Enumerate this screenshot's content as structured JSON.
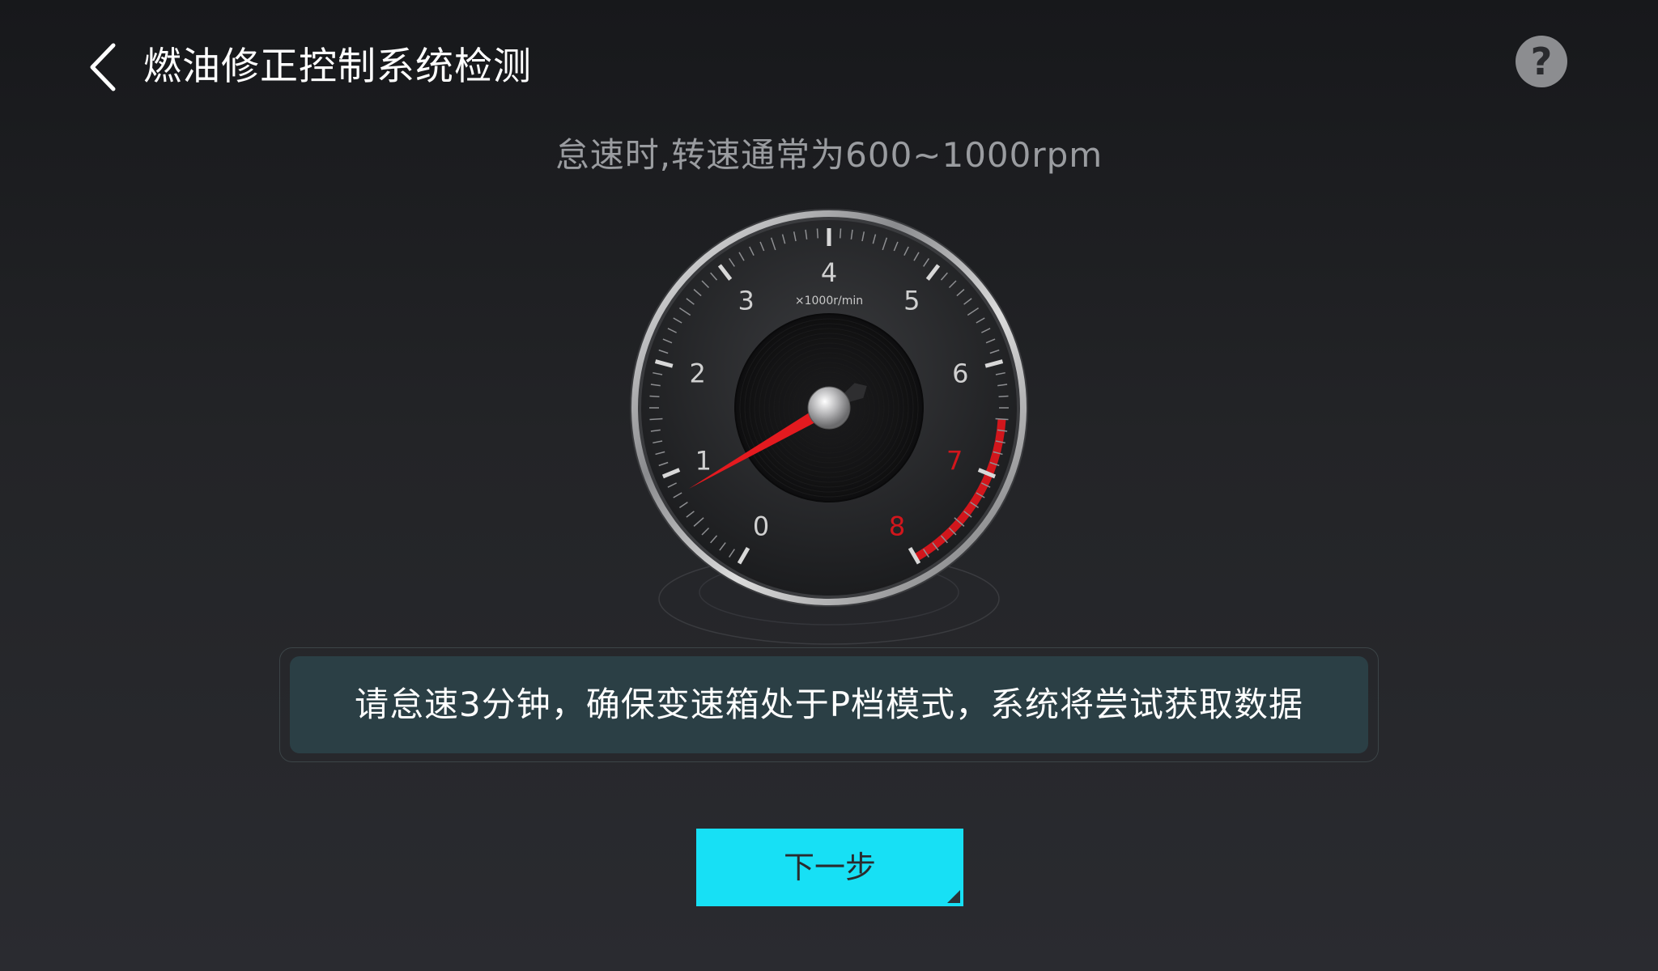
{
  "header": {
    "title": "燃油修正控制系统检测",
    "back_icon": "chevron-left-icon",
    "help_icon": "question-icon",
    "help_label": "?"
  },
  "hint": "怠速时,转速通常为600~1000rpm",
  "gauge": {
    "unit_label": "×1000r/min",
    "tick_labels": [
      "0",
      "1",
      "2",
      "3",
      "4",
      "5",
      "6",
      "7",
      "8"
    ],
    "current_value": 0.8,
    "max_value": 8,
    "redline_start": 6.5,
    "colors": {
      "needle": "#e41a1f",
      "redline": "#d2161c",
      "red_labels": "#d2161c"
    }
  },
  "instruction": "请怠速3分钟，确保变速箱处于P档模式，系统将尝试获取数据",
  "next_button": {
    "label": "下一步",
    "color": "#17e0f5"
  }
}
